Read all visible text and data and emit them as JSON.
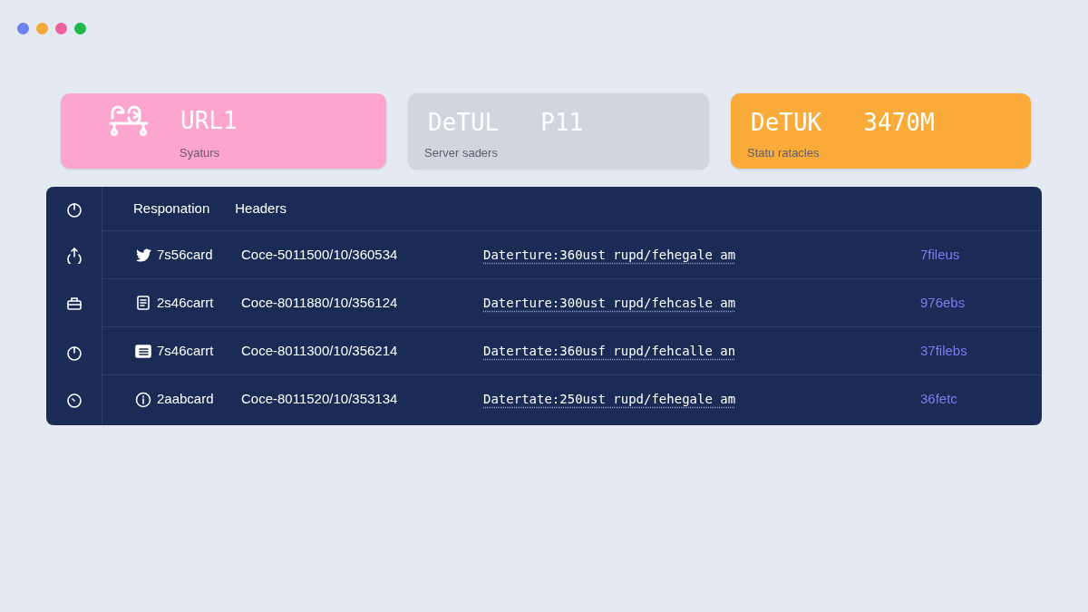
{
  "window_dots": [
    {
      "color": "#6b82f0"
    },
    {
      "color": "#f5a93a"
    },
    {
      "color": "#f0609e"
    },
    {
      "color": "#1fb84a"
    }
  ],
  "cards": [
    {
      "kind": "icon",
      "title": "URL1",
      "subtitle": "Syaturs",
      "color": "#fca5cf"
    },
    {
      "kind": "plain",
      "title": "DeTUL",
      "value": "P11",
      "subtitle": "Server saders",
      "color": "#d1d5de"
    },
    {
      "kind": "plain",
      "title": "DeTUK",
      "value": "3470M",
      "subtitle": "Statu ratacles",
      "color": "#fbab3a"
    }
  ],
  "table": {
    "headers": [
      "Responation",
      "Headers"
    ],
    "rows": [
      {
        "name": "7s56card",
        "code": "Coce-5011500/10/360534",
        "detail": "Daterture:360ust rupd/fehegale am",
        "size": "7fileus"
      },
      {
        "name": "2s46carrt",
        "code": "Coce-8011880/10/356124",
        "detail": "Daterture:300ust rupd/fehcasle am",
        "size": "976ebs"
      },
      {
        "name": "7s46carrt",
        "code": "Coce-8011300/10/356214",
        "detail": "Datertate:360usf rupd/fehcalle an",
        "size": "37filebs"
      },
      {
        "name": "2aabcard",
        "code": "Coce-8011520/10/353134",
        "detail": "Datertate:250ust rupd/fehegale am",
        "size": "36fetc"
      }
    ]
  }
}
